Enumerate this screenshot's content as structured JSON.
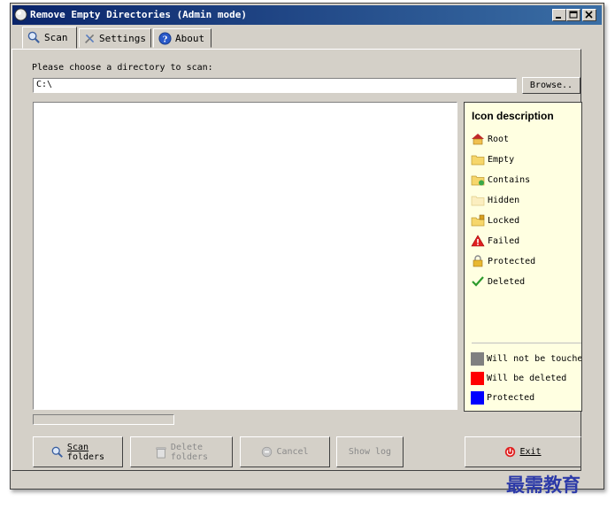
{
  "window": {
    "title": "Remove Empty Directories (Admin mode)"
  },
  "tabs": [
    {
      "label": "Scan",
      "icon": "magnifier-icon",
      "active": true
    },
    {
      "label": "Settings",
      "icon": "tools-icon",
      "active": false
    },
    {
      "label": "About",
      "icon": "info-icon",
      "active": false
    }
  ],
  "scan": {
    "choose_label": "Please choose a directory to scan:",
    "path_value": "C:\\",
    "browse_label": "Browse.."
  },
  "legend": {
    "heading": "Icon description",
    "items": [
      {
        "label": "Root",
        "icon": "root-folder-icon"
      },
      {
        "label": "Empty",
        "icon": "empty-folder-icon"
      },
      {
        "label": "Contains",
        "icon": "contains-folder-icon"
      },
      {
        "label": "Hidden",
        "icon": "hidden-folder-icon"
      },
      {
        "label": "Locked",
        "icon": "locked-folder-icon"
      },
      {
        "label": "Failed",
        "icon": "warning-icon"
      },
      {
        "label": "Protected",
        "icon": "lock-icon"
      },
      {
        "label": "Deleted",
        "icon": "checkmark-icon"
      }
    ],
    "colors": [
      {
        "label": "Will not be touched",
        "color": "#808080"
      },
      {
        "label": "Will be deleted",
        "color": "#ff0000"
      },
      {
        "label": "Protected",
        "color": "#0000ff"
      }
    ]
  },
  "buttons": {
    "scan_folders": {
      "line1": "Scan",
      "line2": "folders"
    },
    "delete_folders": {
      "line1": "Delete",
      "line2": "folders"
    },
    "cancel": "Cancel",
    "show_log": "Show log",
    "exit": "Exit"
  },
  "watermark": "最需教育"
}
